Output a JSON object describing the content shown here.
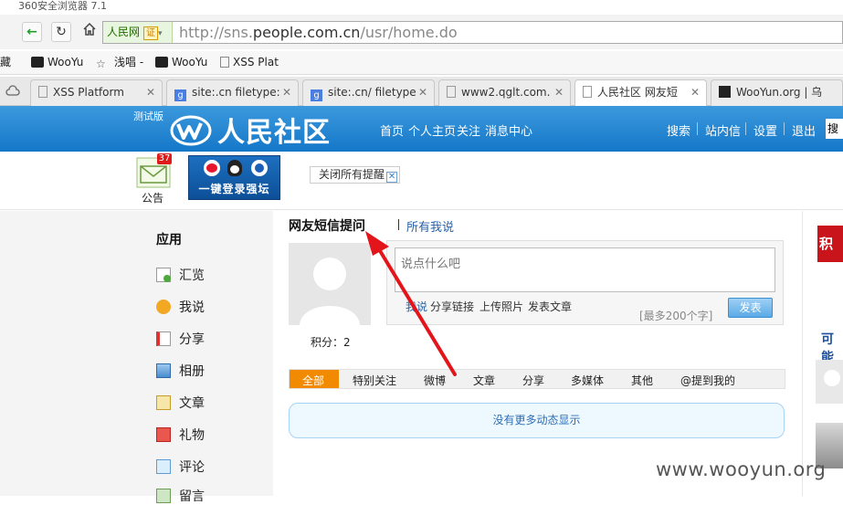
{
  "browser": {
    "title": "360安全浏览器 7.1",
    "site_chip": "人民网",
    "cert": "证",
    "url_pre": "http://sns.",
    "url_domain": "people.com.cn",
    "url_post": "/usr/home.do",
    "bookmarks": [
      "藏",
      "WooYu",
      "浅唱 -",
      "WooYu",
      "XSS Plat"
    ],
    "tabs": [
      "XSS Platform",
      "site:.cn filetype:",
      "site:.cn/ filetype",
      "www2.qglt.com.",
      "人民社区 网友短",
      "WooYun.org | 乌"
    ]
  },
  "header": {
    "test_label": "测试版",
    "logo_text": "人民社区",
    "nav": [
      "首页",
      "个人主页",
      "关注",
      "消息中心"
    ],
    "right_nav": [
      "搜索",
      "站内信",
      "设置",
      "退出"
    ],
    "search_placeholder": "搜索"
  },
  "subbar": {
    "notice_count": "37",
    "notice_label": "公告",
    "login_text": "一键登录强坛",
    "close_tips": "关闭所有提醒"
  },
  "sidebar": {
    "title": "应用",
    "items": [
      "汇览",
      "我说",
      "分享",
      "相册",
      "文章",
      "礼物",
      "评论",
      "留言"
    ]
  },
  "main": {
    "tab_title": "网友短信提问",
    "all_mine": "所有我说",
    "score": "积分：2",
    "post_placeholder": "说点什么吧",
    "post_links": [
      "我说",
      "分享链接",
      "上传照片",
      "发表文章"
    ],
    "limit": "[最多200个字]",
    "publish": "发表",
    "feed_tabs": [
      "全部",
      "特别关注",
      "微博",
      "文章",
      "分享",
      "多媒体",
      "其他",
      "@提到我的"
    ],
    "empty": "没有更多动态显示"
  },
  "right": {
    "ad": "积乐",
    "maybe": "可能"
  },
  "watermark": "www.wooyun.org"
}
